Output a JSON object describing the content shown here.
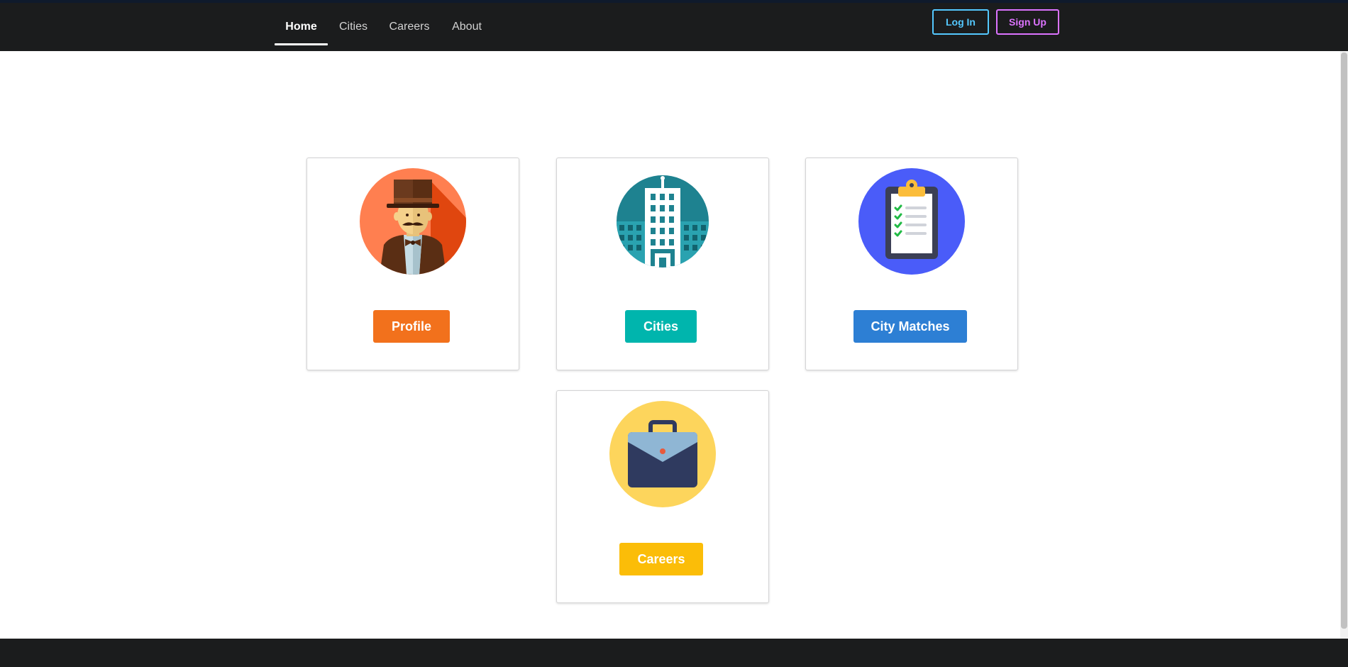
{
  "nav": {
    "items": [
      {
        "label": "Home",
        "active": true
      },
      {
        "label": "Cities",
        "active": false
      },
      {
        "label": "Careers",
        "active": false
      },
      {
        "label": "About",
        "active": false
      }
    ],
    "login_label": "Log In",
    "signup_label": "Sign Up"
  },
  "cards": [
    {
      "icon": "gentleman-avatar-icon",
      "button_label": "Profile",
      "color": "#f2711c"
    },
    {
      "icon": "city-building-icon",
      "button_label": "Cities",
      "color": "#00b5ad"
    },
    {
      "icon": "checklist-clipboard-icon",
      "button_label": "City Matches",
      "color": "#2d7fd4"
    },
    {
      "icon": "briefcase-icon",
      "button_label": "Careers",
      "color": "#fbbd08"
    }
  ],
  "colors": {
    "navbar": "#1b1c1d",
    "login_accent": "#54c8ff",
    "signup_accent": "#dc73ff"
  }
}
